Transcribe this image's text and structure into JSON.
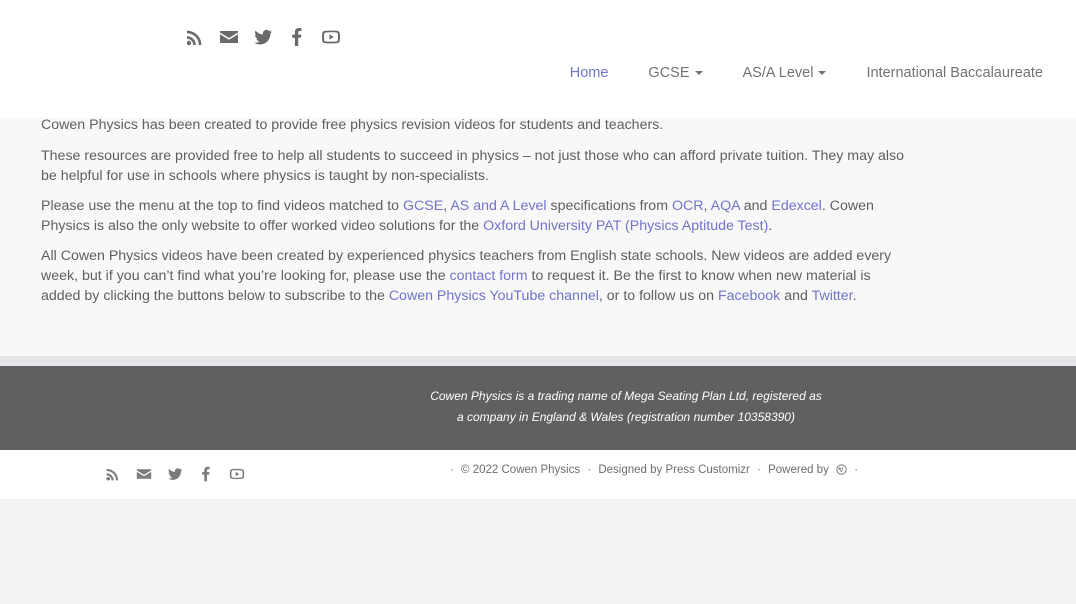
{
  "header": {
    "social_icons": [
      "rss-icon",
      "email-icon",
      "twitter-icon",
      "facebook-icon",
      "youtube-icon"
    ],
    "nav": {
      "home": "Home",
      "gcse": "GCSE",
      "as_a_level": "AS/A Level",
      "ib": "International Baccalaureate"
    }
  },
  "content": {
    "p1": "Cowen Physics has been created to provide free physics revision videos for students and teachers.",
    "p2": "These resources are provided free to help all students to succeed in physics – not just those who can afford private tuition. They may also be helpful for use in schools where physics is taught by non-specialists.",
    "p3": {
      "t1": "Please use the menu at the top to find videos matched to ",
      "link_gcse": "GCSE",
      "t2": ", ",
      "link_as_a": "AS and A Level",
      "t3": " specifications from ",
      "link_ocr": "OCR",
      "t4": ", ",
      "link_aqa": "AQA",
      "t5": " and ",
      "link_edexcel": "Edexcel",
      "t6": ". Cowen Physics is also the only website to offer worked video solutions for the ",
      "link_pat": "Oxford University PAT (Physics Aptitude Test)",
      "t7": "."
    },
    "p4": {
      "t1": "All Cowen Physics videos have been created by experienced physics teachers from English state schools. New videos are added every week, but if you can’t find what you’re looking for, please use the ",
      "link_contact": "contact form",
      "t2": " to request it. Be the first to know when new material is added by clicking the buttons below to subscribe to the ",
      "link_youtube": "Cowen Physics YouTube channel",
      "t3": ", or to follow us on ",
      "link_facebook": "Facebook",
      "t4": " and ",
      "link_twitter": "Twitter",
      "t5": "."
    }
  },
  "footer": {
    "note": "Cowen Physics is a trading name of Mega Seating Plan Ltd, registered as a company in England & Wales (registration number 10358390)",
    "credits": {
      "sep": "·",
      "copyright": "© 2022 Cowen Physics",
      "designed": "Designed by Press Customizr",
      "powered": "Powered by"
    },
    "social_icons": [
      "rss-icon",
      "email-icon",
      "twitter-icon",
      "facebook-icon",
      "youtube-icon"
    ]
  }
}
